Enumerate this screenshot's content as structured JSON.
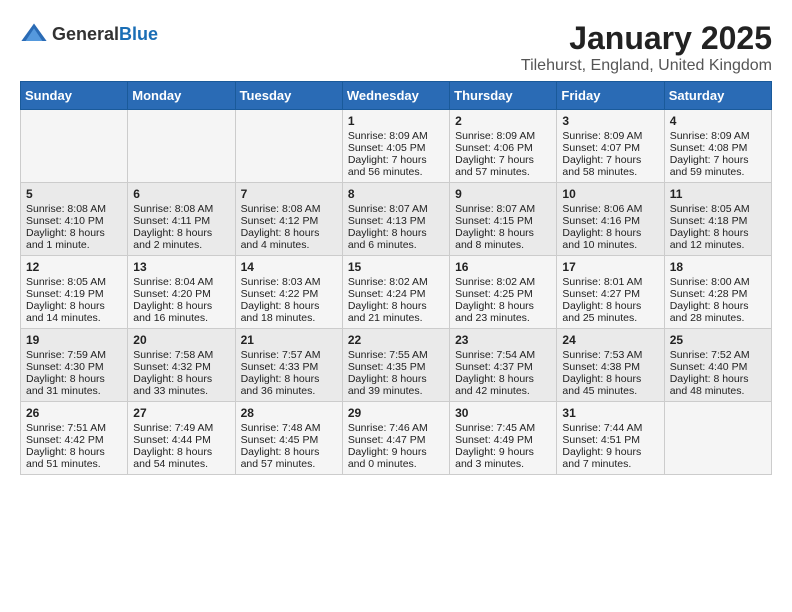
{
  "app": {
    "logo_general": "General",
    "logo_blue": "Blue"
  },
  "header": {
    "title": "January 2025",
    "subtitle": "Tilehurst, England, United Kingdom"
  },
  "weekdays": [
    "Sunday",
    "Monday",
    "Tuesday",
    "Wednesday",
    "Thursday",
    "Friday",
    "Saturday"
  ],
  "weeks": [
    [
      {
        "day": "",
        "info": ""
      },
      {
        "day": "",
        "info": ""
      },
      {
        "day": "",
        "info": ""
      },
      {
        "day": "1",
        "info": "Sunrise: 8:09 AM\nSunset: 4:05 PM\nDaylight: 7 hours\nand 56 minutes."
      },
      {
        "day": "2",
        "info": "Sunrise: 8:09 AM\nSunset: 4:06 PM\nDaylight: 7 hours\nand 57 minutes."
      },
      {
        "day": "3",
        "info": "Sunrise: 8:09 AM\nSunset: 4:07 PM\nDaylight: 7 hours\nand 58 minutes."
      },
      {
        "day": "4",
        "info": "Sunrise: 8:09 AM\nSunset: 4:08 PM\nDaylight: 7 hours\nand 59 minutes."
      }
    ],
    [
      {
        "day": "5",
        "info": "Sunrise: 8:08 AM\nSunset: 4:10 PM\nDaylight: 8 hours\nand 1 minute."
      },
      {
        "day": "6",
        "info": "Sunrise: 8:08 AM\nSunset: 4:11 PM\nDaylight: 8 hours\nand 2 minutes."
      },
      {
        "day": "7",
        "info": "Sunrise: 8:08 AM\nSunset: 4:12 PM\nDaylight: 8 hours\nand 4 minutes."
      },
      {
        "day": "8",
        "info": "Sunrise: 8:07 AM\nSunset: 4:13 PM\nDaylight: 8 hours\nand 6 minutes."
      },
      {
        "day": "9",
        "info": "Sunrise: 8:07 AM\nSunset: 4:15 PM\nDaylight: 8 hours\nand 8 minutes."
      },
      {
        "day": "10",
        "info": "Sunrise: 8:06 AM\nSunset: 4:16 PM\nDaylight: 8 hours\nand 10 minutes."
      },
      {
        "day": "11",
        "info": "Sunrise: 8:05 AM\nSunset: 4:18 PM\nDaylight: 8 hours\nand 12 minutes."
      }
    ],
    [
      {
        "day": "12",
        "info": "Sunrise: 8:05 AM\nSunset: 4:19 PM\nDaylight: 8 hours\nand 14 minutes."
      },
      {
        "day": "13",
        "info": "Sunrise: 8:04 AM\nSunset: 4:20 PM\nDaylight: 8 hours\nand 16 minutes."
      },
      {
        "day": "14",
        "info": "Sunrise: 8:03 AM\nSunset: 4:22 PM\nDaylight: 8 hours\nand 18 minutes."
      },
      {
        "day": "15",
        "info": "Sunrise: 8:02 AM\nSunset: 4:24 PM\nDaylight: 8 hours\nand 21 minutes."
      },
      {
        "day": "16",
        "info": "Sunrise: 8:02 AM\nSunset: 4:25 PM\nDaylight: 8 hours\nand 23 minutes."
      },
      {
        "day": "17",
        "info": "Sunrise: 8:01 AM\nSunset: 4:27 PM\nDaylight: 8 hours\nand 25 minutes."
      },
      {
        "day": "18",
        "info": "Sunrise: 8:00 AM\nSunset: 4:28 PM\nDaylight: 8 hours\nand 28 minutes."
      }
    ],
    [
      {
        "day": "19",
        "info": "Sunrise: 7:59 AM\nSunset: 4:30 PM\nDaylight: 8 hours\nand 31 minutes."
      },
      {
        "day": "20",
        "info": "Sunrise: 7:58 AM\nSunset: 4:32 PM\nDaylight: 8 hours\nand 33 minutes."
      },
      {
        "day": "21",
        "info": "Sunrise: 7:57 AM\nSunset: 4:33 PM\nDaylight: 8 hours\nand 36 minutes."
      },
      {
        "day": "22",
        "info": "Sunrise: 7:55 AM\nSunset: 4:35 PM\nDaylight: 8 hours\nand 39 minutes."
      },
      {
        "day": "23",
        "info": "Sunrise: 7:54 AM\nSunset: 4:37 PM\nDaylight: 8 hours\nand 42 minutes."
      },
      {
        "day": "24",
        "info": "Sunrise: 7:53 AM\nSunset: 4:38 PM\nDaylight: 8 hours\nand 45 minutes."
      },
      {
        "day": "25",
        "info": "Sunrise: 7:52 AM\nSunset: 4:40 PM\nDaylight: 8 hours\nand 48 minutes."
      }
    ],
    [
      {
        "day": "26",
        "info": "Sunrise: 7:51 AM\nSunset: 4:42 PM\nDaylight: 8 hours\nand 51 minutes."
      },
      {
        "day": "27",
        "info": "Sunrise: 7:49 AM\nSunset: 4:44 PM\nDaylight: 8 hours\nand 54 minutes."
      },
      {
        "day": "28",
        "info": "Sunrise: 7:48 AM\nSunset: 4:45 PM\nDaylight: 8 hours\nand 57 minutes."
      },
      {
        "day": "29",
        "info": "Sunrise: 7:46 AM\nSunset: 4:47 PM\nDaylight: 9 hours\nand 0 minutes."
      },
      {
        "day": "30",
        "info": "Sunrise: 7:45 AM\nSunset: 4:49 PM\nDaylight: 9 hours\nand 3 minutes."
      },
      {
        "day": "31",
        "info": "Sunrise: 7:44 AM\nSunset: 4:51 PM\nDaylight: 9 hours\nand 7 minutes."
      },
      {
        "day": "",
        "info": ""
      }
    ]
  ]
}
